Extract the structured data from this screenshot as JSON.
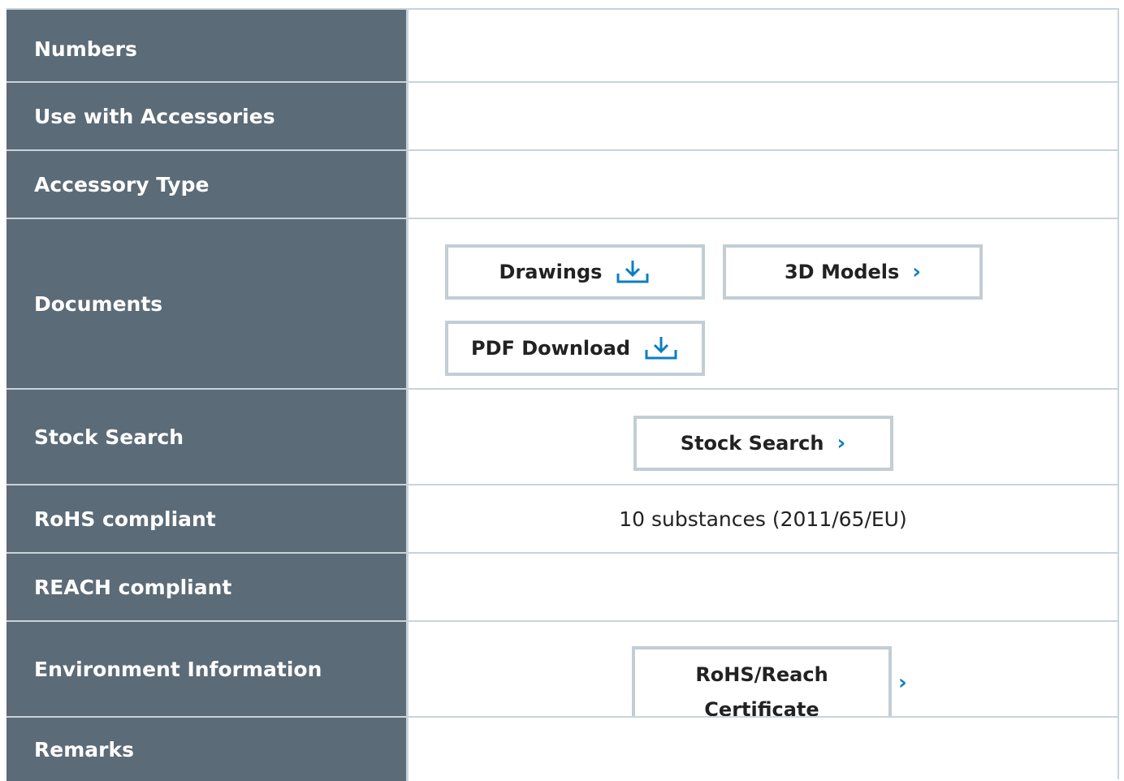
{
  "rows": {
    "application_numbers": {
      "label": "Numbers"
    },
    "use_with_accessories": {
      "label": "Use with Accessories"
    },
    "accessory_type": {
      "label": "Accessory Type"
    },
    "documents": {
      "label": "Documents",
      "drawings": "Drawings",
      "models": "3D Models",
      "pdf": "PDF Download"
    },
    "stock_search": {
      "label": "Stock Search",
      "button": "Stock Search"
    },
    "rohs": {
      "label": "RoHS compliant",
      "value": "10 substances (2011/65/EU)"
    },
    "reach": {
      "label": "REACH compliant"
    },
    "environment": {
      "label": "Environment Information",
      "button_line1": "RoHS/Reach",
      "button_line2": "Certificate"
    },
    "remarks": {
      "label": "Remarks"
    }
  },
  "icons": {
    "download": "download-icon",
    "chevron": "chevron-right-icon"
  },
  "colors": {
    "label_bg": "#5b6b77",
    "border": "#c9d3da",
    "accent": "#0a7fc0"
  }
}
